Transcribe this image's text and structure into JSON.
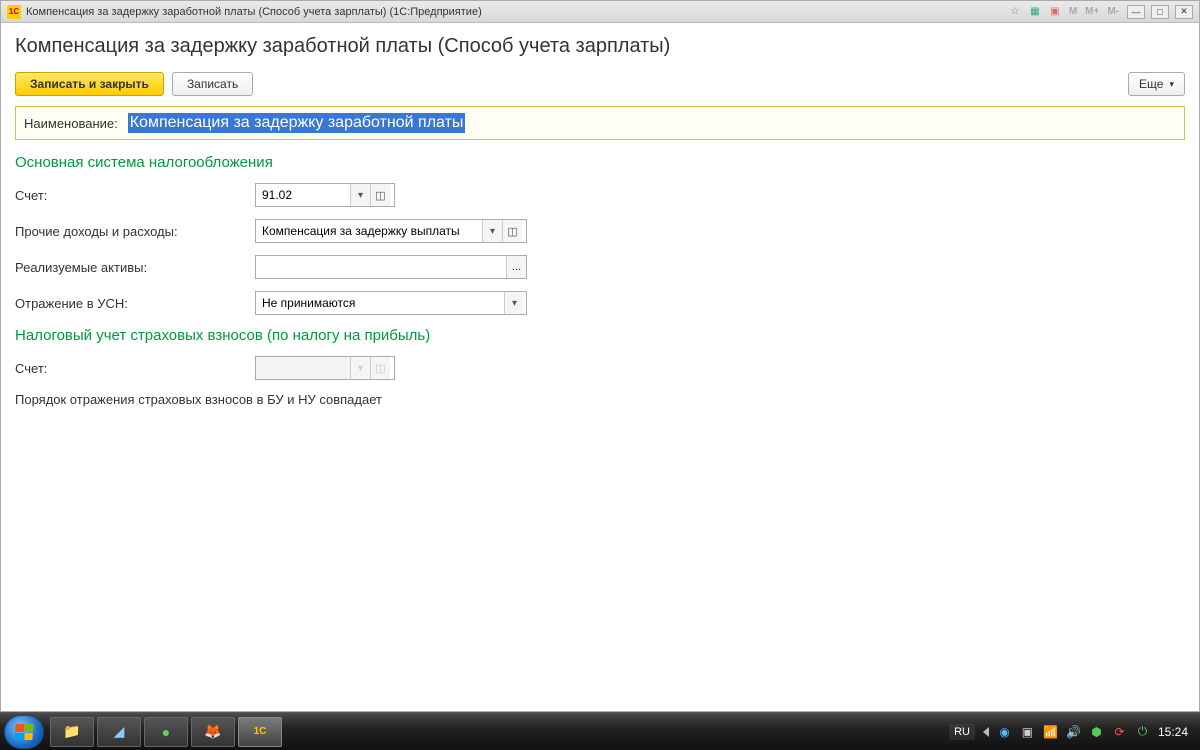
{
  "titlebar": {
    "logo_text": "1C",
    "title": "Компенсация за задержку заработной платы (Способ учета зарплаты)  (1С:Предприятие)",
    "m1": "M",
    "m2": "M+",
    "m3": "M-"
  },
  "page": {
    "heading": "Компенсация за задержку заработной платы (Способ учета зарплаты)"
  },
  "toolbar": {
    "save_close": "Записать и закрыть",
    "save": "Записать",
    "more": "Еще"
  },
  "name_field": {
    "label": "Наименование:",
    "value": "Компенсация за задержку заработной платы"
  },
  "section1": {
    "title": "Основная система налогообложения",
    "account_label": "Счет:",
    "account_value": "91.02",
    "other_label": "Прочие доходы и расходы:",
    "other_value": "Компенсация за задержку выплаты",
    "assets_label": "Реализуемые активы:",
    "assets_value": "",
    "usn_label": "Отражение в УСН:",
    "usn_value": "Не принимаются"
  },
  "section2": {
    "title": "Налоговый учет страховых взносов (по налогу на прибыль)",
    "account2_label": "Счет:",
    "account2_value": "",
    "note": "Порядок отражения страховых взносов в БУ и НУ совпадает"
  },
  "taskbar": {
    "lang": "RU",
    "time": "15:24"
  }
}
